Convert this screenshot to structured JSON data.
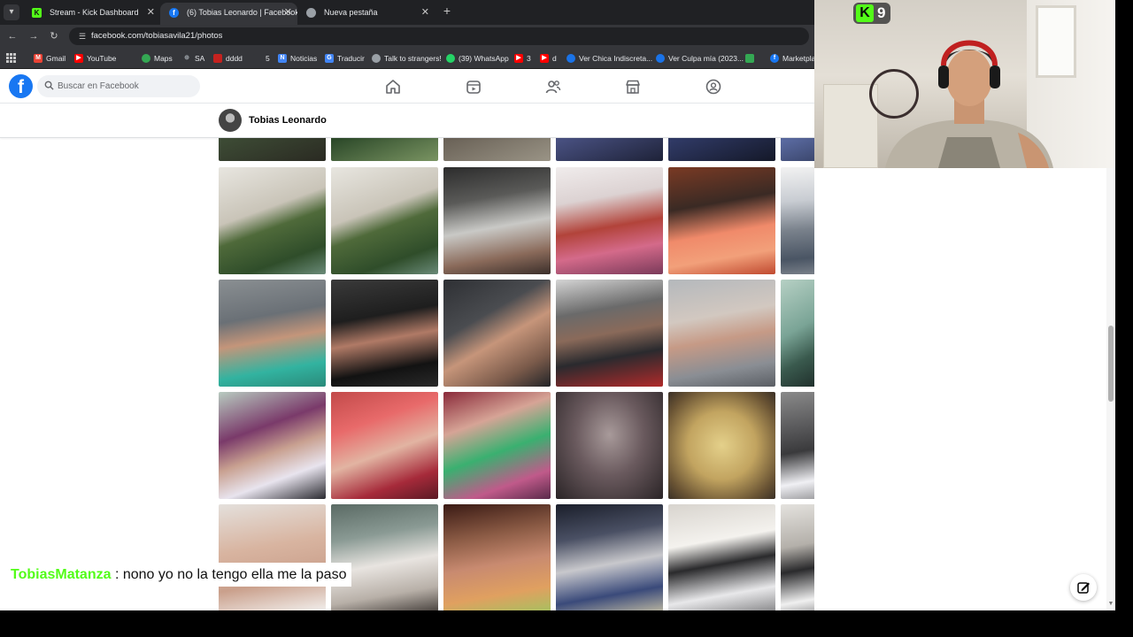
{
  "browser": {
    "tabs": [
      {
        "label": "Stream - Kick Dashboard",
        "favicon": "kick-icon",
        "active": false
      },
      {
        "label": "(6) Tobias Leonardo | Facebook",
        "favicon": "facebook-icon",
        "active": true
      },
      {
        "label": "Nueva pestaña",
        "favicon": "chrome-icon",
        "active": false
      }
    ],
    "url": "facebook.com/tobiasavila21/photos",
    "bookmarks": [
      "Gmail",
      "YouTube",
      "Maps",
      "SA",
      "dddd",
      "5",
      "Noticias",
      "Traducir",
      "Talk to strangers!",
      "(39) WhatsApp",
      "3",
      "d",
      "Ver Chica Indiscreta...",
      "Ver Culpa mía (2023...",
      "Marketpla"
    ]
  },
  "facebook": {
    "search_placeholder": "Buscar en Facebook",
    "profile_name": "Tobias Leonardo",
    "nav_icons": [
      "home-icon",
      "video-icon",
      "friends-icon",
      "marketplace-icon",
      "groups-icon"
    ]
  },
  "webcam": {
    "viewer_count": "9"
  },
  "chat": {
    "username": "TobiasMatanza",
    "separator": " : ",
    "message": "nono yo no la tengo ella me la paso"
  },
  "colors": {
    "facebook_blue": "#1877f2",
    "kick_green": "#53fc18",
    "chrome_dark": "#202124",
    "chrome_tab": "#35363a"
  }
}
